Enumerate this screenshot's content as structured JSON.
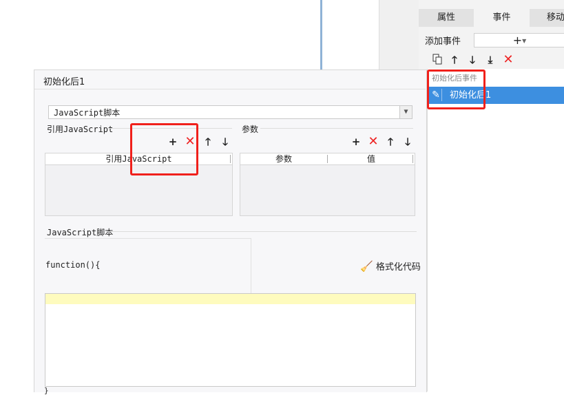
{
  "right_panel": {
    "tabs": [
      "属性",
      "事件",
      "移动端"
    ],
    "active_tab": 1,
    "add_event_label": "添加事件",
    "add_symbol": "+",
    "toolbar_icons": [
      "copy-icon",
      "arrow-up-icon",
      "arrow-down-icon",
      "move-bottom-icon",
      "delete-icon"
    ],
    "event_group": "初始化后事件",
    "event_item": "初始化后1"
  },
  "dialog": {
    "title": "初始化后1",
    "type_select_value": "JavaScript脚本",
    "ref_js_section": "引用JavaScript",
    "ref_js_column": "引用JavaScript",
    "params_section": "参数",
    "params_columns": [
      "参数",
      "值"
    ],
    "script_section": "JavaScript脚本",
    "code_header": "function(){",
    "code_footer": "}",
    "format_button": "格式化代码"
  },
  "colors": {
    "accent": "#3d8fe0",
    "annotation_red": "#f0201b",
    "delete_red": "#e22222",
    "editor_highlight": "#fefbbe"
  }
}
